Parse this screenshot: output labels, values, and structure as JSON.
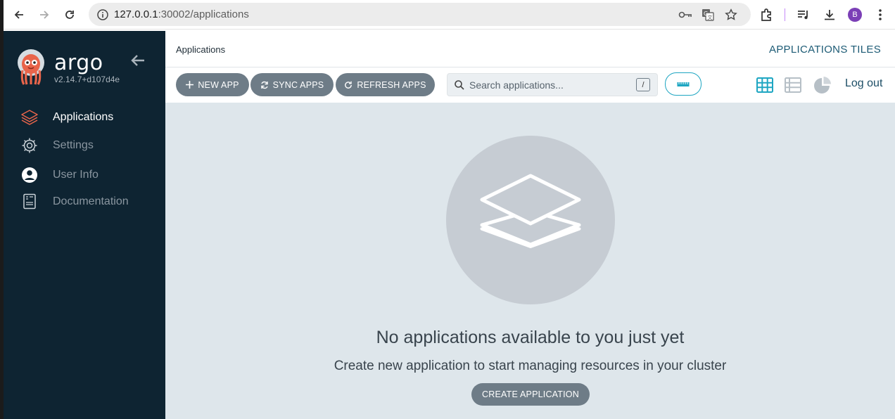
{
  "browser": {
    "url_host": "127.0.0.1",
    "url_path": ":30002/applications",
    "profile_initial": "B"
  },
  "sidebar": {
    "brand": "argo",
    "version": "v2.14.7+d107d4e",
    "items": [
      {
        "label": "Applications",
        "icon": "layers-icon",
        "active": true
      },
      {
        "label": "Settings",
        "icon": "gear-icon",
        "active": false
      },
      {
        "label": "User Info",
        "icon": "user-icon",
        "active": false
      },
      {
        "label": "Documentation",
        "icon": "book-icon",
        "active": false
      }
    ]
  },
  "header": {
    "page_title": "Applications",
    "view_title": "APPLICATIONS TILES"
  },
  "toolbar": {
    "new_app": "NEW APP",
    "sync_apps": "SYNC APPS",
    "refresh_apps": "REFRESH APPS",
    "search_placeholder": "Search applications...",
    "search_shortcut": "/",
    "logout": "Log out"
  },
  "empty_state": {
    "title": "No applications available to you just yet",
    "subtitle": "Create new application to start managing resources in your cluster",
    "create_button": "CREATE APPLICATION"
  },
  "colors": {
    "sidebar_bg": "#0e2432",
    "button_bg": "#6e7c87",
    "content_bg": "#dee6eb",
    "accent": "#1ea6c2"
  }
}
